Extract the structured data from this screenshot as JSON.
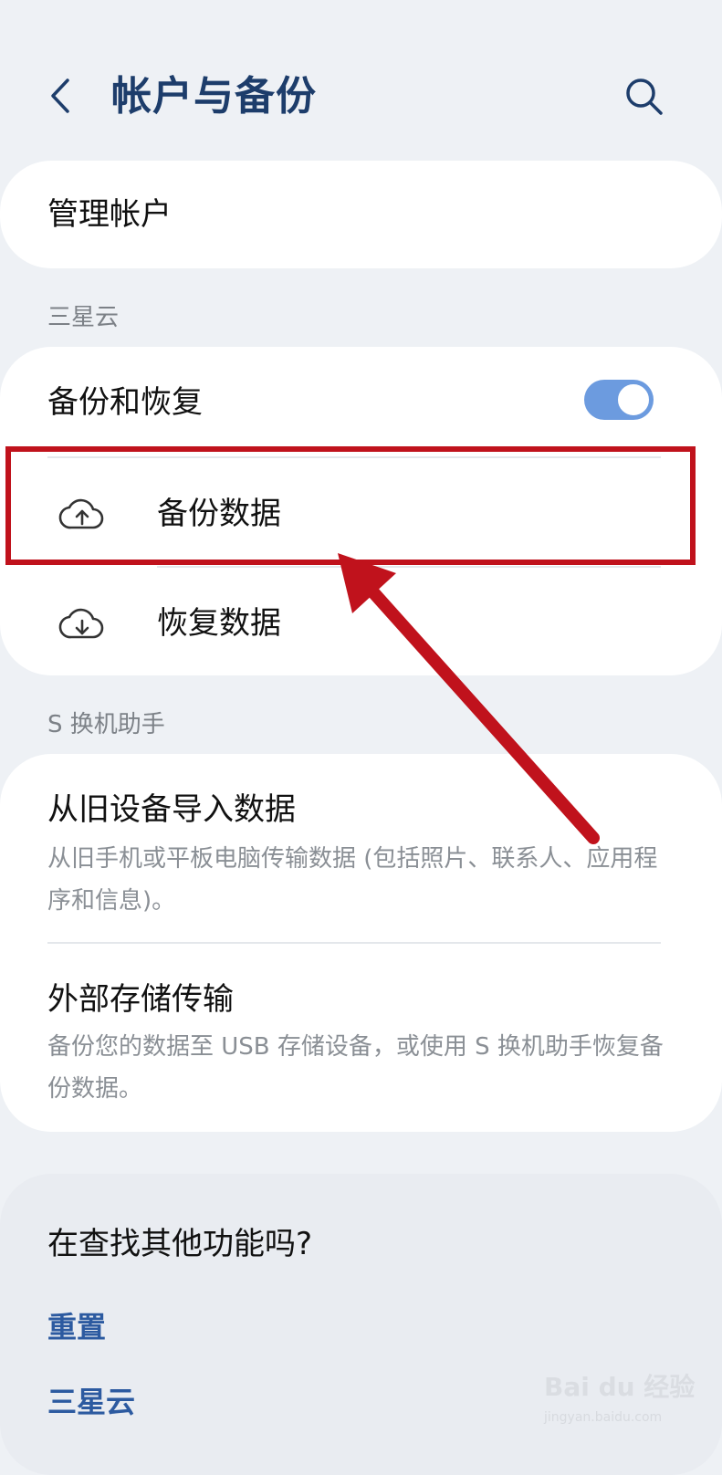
{
  "header": {
    "title": "帐户与备份",
    "back_icon": "chevron-left-icon",
    "search_icon": "search-icon"
  },
  "manage": {
    "label": "管理帐户"
  },
  "cloud_section": {
    "label": "三星云",
    "backup_restore": {
      "label": "备份和恢复",
      "toggle_on": true
    },
    "backup_data": {
      "label": "备份数据",
      "icon": "cloud-upload-icon"
    },
    "restore_data": {
      "label": "恢复数据",
      "icon": "cloud-download-icon"
    }
  },
  "switch_section": {
    "label": "S 换机助手",
    "import": {
      "title": "从旧设备导入数据",
      "desc": "从旧手机或平板电脑传输数据 (包括照片、联系人、应用程序和信息)。"
    },
    "external": {
      "title": "外部存储传输",
      "desc": "备份您的数据至 USB 存储设备，或使用 S 换机助手恢复备份数据。"
    }
  },
  "find_section": {
    "title": "在查找其他功能吗?",
    "links": [
      "重置",
      "三星云"
    ]
  },
  "watermark": {
    "logo": "Bai du 经验",
    "sub": "jingyan.baidu.com"
  },
  "colors": {
    "background": "#eef1f5",
    "title": "#1d3d6b",
    "accent": "#6c9bdf",
    "link": "#2c5aa0",
    "annotation": "#c0121c"
  }
}
